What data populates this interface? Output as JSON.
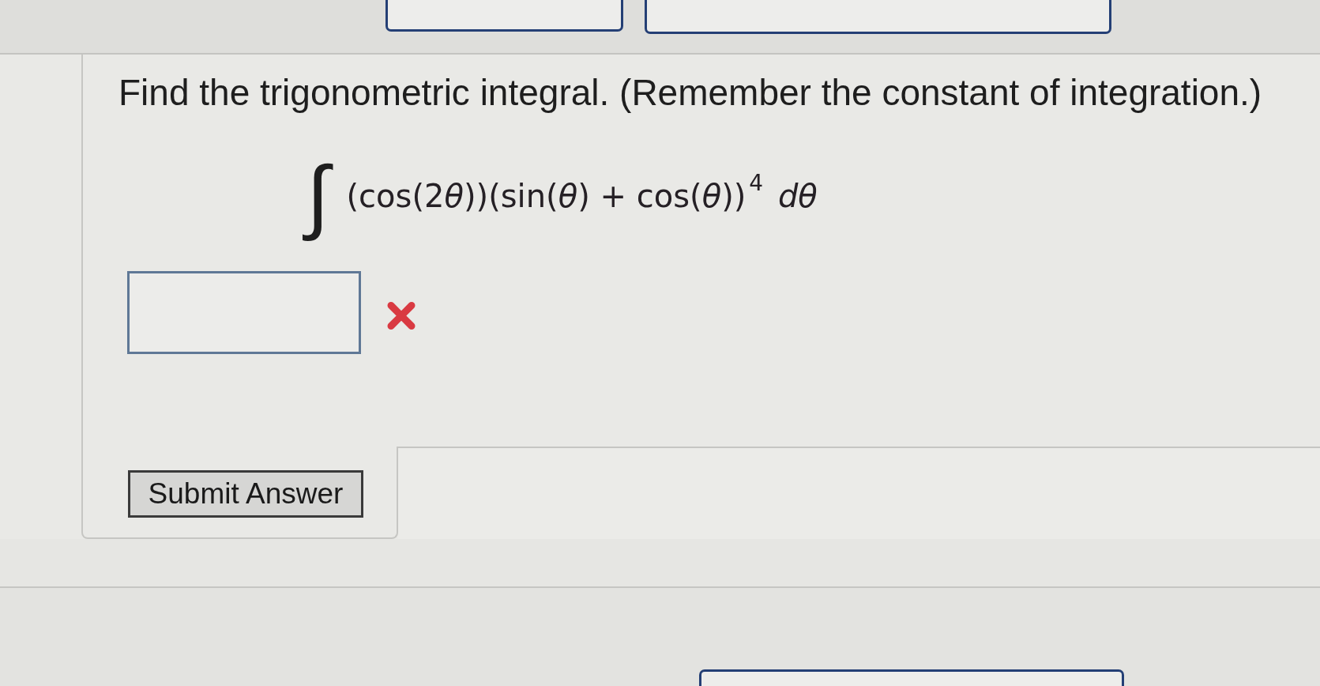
{
  "question": {
    "text": "Find the trigonometric integral. (Remember the constant of integration.)",
    "integral_sign": "∫",
    "integrand": [
      {
        "kind": "text",
        "text": "(cos(2"
      },
      {
        "kind": "variable",
        "text": "θ"
      },
      {
        "kind": "text",
        "text": "))(sin("
      },
      {
        "kind": "variable",
        "text": "θ"
      },
      {
        "kind": "text",
        "text": ") + cos("
      },
      {
        "kind": "variable",
        "text": "θ"
      },
      {
        "kind": "text",
        "text": "))"
      },
      {
        "kind": "exponent",
        "text": "4"
      },
      {
        "kind": "differential",
        "text": "dθ"
      }
    ]
  },
  "answer": {
    "correct": false
  },
  "submit_button": {
    "label": "Submit Answer"
  }
}
